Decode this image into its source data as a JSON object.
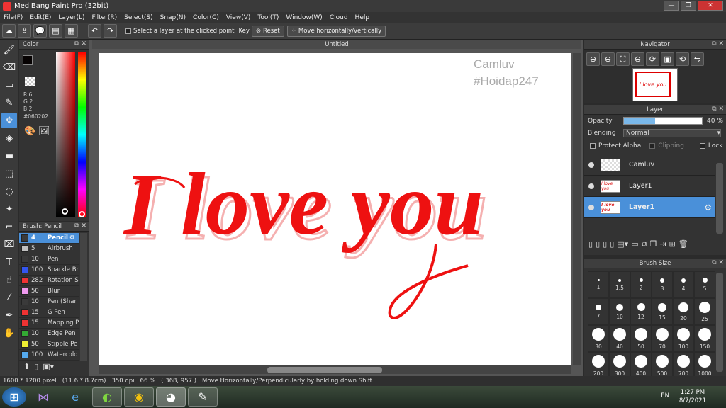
{
  "window": {
    "title": "MediBang Paint Pro (32bit)"
  },
  "menu": [
    "File(F)",
    "Edit(E)",
    "Layer(L)",
    "Filter(R)",
    "Select(S)",
    "Snap(N)",
    "Color(C)",
    "View(V)",
    "Tool(T)",
    "Window(W)",
    "Cloud",
    "Help"
  ],
  "toolbar": {
    "select_layer_label": "Select a layer at the clicked point",
    "key_label": "Key",
    "reset_label": "Reset",
    "move_label": "Move horizontally/vertically"
  },
  "color_panel": {
    "title": "Color",
    "r": "R:6",
    "g": "G:2",
    "b": "B:2",
    "hex": "#060202",
    "primary_color": "#060202",
    "secondary_color": "#ffffff"
  },
  "brush_panel": {
    "title": "Brush: Pencil",
    "items": [
      {
        "size": "4",
        "name": "Pencil",
        "color": "#3a3a3a"
      },
      {
        "size": "5",
        "name": "Airbrush",
        "color": "#c0c0c0"
      },
      {
        "size": "10",
        "name": "Pen",
        "color": "#3a3a3a"
      },
      {
        "size": "100",
        "name": "Sparkle Br",
        "color": "#3355ee"
      },
      {
        "size": "282",
        "name": "Rotation S",
        "color": "#ee3333"
      },
      {
        "size": "50",
        "name": "Blur",
        "color": "#ee99ee"
      },
      {
        "size": "10",
        "name": "Pen (Shar",
        "color": "#3a3a3a"
      },
      {
        "size": "15",
        "name": "G Pen",
        "color": "#ee3333"
      },
      {
        "size": "15",
        "name": "Mapping P",
        "color": "#ee3333"
      },
      {
        "size": "10",
        "name": "Edge Pen",
        "color": "#33aa33"
      },
      {
        "size": "50",
        "name": "Stipple Pe",
        "color": "#eeee33"
      },
      {
        "size": "100",
        "name": "Watercolo",
        "color": "#55aaee"
      }
    ]
  },
  "canvas": {
    "tab_title": "Untitled",
    "watermark_line1": "Camluv",
    "watermark_line2": "#Hoidap247",
    "lettering": "I love you",
    "ink_color": "#ee1111"
  },
  "navigator": {
    "title": "Navigator"
  },
  "layer_panel": {
    "title": "Layer",
    "opacity_label": "Opacity",
    "opacity_value": "40 %",
    "opacity_fraction": 0.4,
    "blending_label": "Blending",
    "blending_value": "Normal",
    "protect_alpha": "Protect Alpha",
    "clipping": "Clipping",
    "lock": "Lock",
    "layers": [
      {
        "name": "Camluv",
        "thumb": ""
      },
      {
        "name": "Layer1",
        "thumb": "I love you"
      },
      {
        "name": "Layer1",
        "thumb": "I love you"
      }
    ]
  },
  "brush_size": {
    "title": "Brush Size",
    "sizes": [
      "1",
      "1.5",
      "2",
      "3",
      "4",
      "5",
      "7",
      "10",
      "12",
      "15",
      "20",
      "25",
      "30",
      "40",
      "50",
      "70",
      "100",
      "150",
      "200",
      "300",
      "400",
      "500",
      "700",
      "1000"
    ]
  },
  "status": {
    "dims": "1600 * 1200 pixel",
    "cm": "(11.6 * 8.7cm)",
    "dpi": "350 dpi",
    "zoom": "66 %",
    "coords": "( 368, 957 )",
    "hint": "Move Horizontally/Perpendicularly by holding down Shift"
  },
  "taskbar": {
    "lang": "EN",
    "time": "1:27 PM",
    "date": "8/7/2021"
  }
}
